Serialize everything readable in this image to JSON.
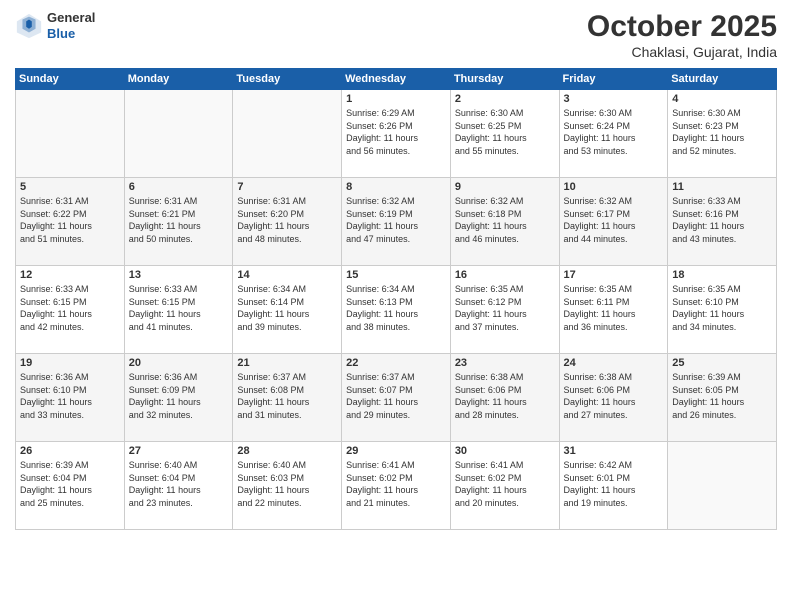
{
  "logo": {
    "general": "General",
    "blue": "Blue"
  },
  "title": "October 2025",
  "subtitle": "Chaklasi, Gujarat, India",
  "days_header": [
    "Sunday",
    "Monday",
    "Tuesday",
    "Wednesday",
    "Thursday",
    "Friday",
    "Saturday"
  ],
  "weeks": [
    [
      {
        "day": "",
        "info": ""
      },
      {
        "day": "",
        "info": ""
      },
      {
        "day": "",
        "info": ""
      },
      {
        "day": "1",
        "info": "Sunrise: 6:29 AM\nSunset: 6:26 PM\nDaylight: 11 hours\nand 56 minutes."
      },
      {
        "day": "2",
        "info": "Sunrise: 6:30 AM\nSunset: 6:25 PM\nDaylight: 11 hours\nand 55 minutes."
      },
      {
        "day": "3",
        "info": "Sunrise: 6:30 AM\nSunset: 6:24 PM\nDaylight: 11 hours\nand 53 minutes."
      },
      {
        "day": "4",
        "info": "Sunrise: 6:30 AM\nSunset: 6:23 PM\nDaylight: 11 hours\nand 52 minutes."
      }
    ],
    [
      {
        "day": "5",
        "info": "Sunrise: 6:31 AM\nSunset: 6:22 PM\nDaylight: 11 hours\nand 51 minutes."
      },
      {
        "day": "6",
        "info": "Sunrise: 6:31 AM\nSunset: 6:21 PM\nDaylight: 11 hours\nand 50 minutes."
      },
      {
        "day": "7",
        "info": "Sunrise: 6:31 AM\nSunset: 6:20 PM\nDaylight: 11 hours\nand 48 minutes."
      },
      {
        "day": "8",
        "info": "Sunrise: 6:32 AM\nSunset: 6:19 PM\nDaylight: 11 hours\nand 47 minutes."
      },
      {
        "day": "9",
        "info": "Sunrise: 6:32 AM\nSunset: 6:18 PM\nDaylight: 11 hours\nand 46 minutes."
      },
      {
        "day": "10",
        "info": "Sunrise: 6:32 AM\nSunset: 6:17 PM\nDaylight: 11 hours\nand 44 minutes."
      },
      {
        "day": "11",
        "info": "Sunrise: 6:33 AM\nSunset: 6:16 PM\nDaylight: 11 hours\nand 43 minutes."
      }
    ],
    [
      {
        "day": "12",
        "info": "Sunrise: 6:33 AM\nSunset: 6:15 PM\nDaylight: 11 hours\nand 42 minutes."
      },
      {
        "day": "13",
        "info": "Sunrise: 6:33 AM\nSunset: 6:15 PM\nDaylight: 11 hours\nand 41 minutes."
      },
      {
        "day": "14",
        "info": "Sunrise: 6:34 AM\nSunset: 6:14 PM\nDaylight: 11 hours\nand 39 minutes."
      },
      {
        "day": "15",
        "info": "Sunrise: 6:34 AM\nSunset: 6:13 PM\nDaylight: 11 hours\nand 38 minutes."
      },
      {
        "day": "16",
        "info": "Sunrise: 6:35 AM\nSunset: 6:12 PM\nDaylight: 11 hours\nand 37 minutes."
      },
      {
        "day": "17",
        "info": "Sunrise: 6:35 AM\nSunset: 6:11 PM\nDaylight: 11 hours\nand 36 minutes."
      },
      {
        "day": "18",
        "info": "Sunrise: 6:35 AM\nSunset: 6:10 PM\nDaylight: 11 hours\nand 34 minutes."
      }
    ],
    [
      {
        "day": "19",
        "info": "Sunrise: 6:36 AM\nSunset: 6:10 PM\nDaylight: 11 hours\nand 33 minutes."
      },
      {
        "day": "20",
        "info": "Sunrise: 6:36 AM\nSunset: 6:09 PM\nDaylight: 11 hours\nand 32 minutes."
      },
      {
        "day": "21",
        "info": "Sunrise: 6:37 AM\nSunset: 6:08 PM\nDaylight: 11 hours\nand 31 minutes."
      },
      {
        "day": "22",
        "info": "Sunrise: 6:37 AM\nSunset: 6:07 PM\nDaylight: 11 hours\nand 29 minutes."
      },
      {
        "day": "23",
        "info": "Sunrise: 6:38 AM\nSunset: 6:06 PM\nDaylight: 11 hours\nand 28 minutes."
      },
      {
        "day": "24",
        "info": "Sunrise: 6:38 AM\nSunset: 6:06 PM\nDaylight: 11 hours\nand 27 minutes."
      },
      {
        "day": "25",
        "info": "Sunrise: 6:39 AM\nSunset: 6:05 PM\nDaylight: 11 hours\nand 26 minutes."
      }
    ],
    [
      {
        "day": "26",
        "info": "Sunrise: 6:39 AM\nSunset: 6:04 PM\nDaylight: 11 hours\nand 25 minutes."
      },
      {
        "day": "27",
        "info": "Sunrise: 6:40 AM\nSunset: 6:04 PM\nDaylight: 11 hours\nand 23 minutes."
      },
      {
        "day": "28",
        "info": "Sunrise: 6:40 AM\nSunset: 6:03 PM\nDaylight: 11 hours\nand 22 minutes."
      },
      {
        "day": "29",
        "info": "Sunrise: 6:41 AM\nSunset: 6:02 PM\nDaylight: 11 hours\nand 21 minutes."
      },
      {
        "day": "30",
        "info": "Sunrise: 6:41 AM\nSunset: 6:02 PM\nDaylight: 11 hours\nand 20 minutes."
      },
      {
        "day": "31",
        "info": "Sunrise: 6:42 AM\nSunset: 6:01 PM\nDaylight: 11 hours\nand 19 minutes."
      },
      {
        "day": "",
        "info": ""
      }
    ]
  ]
}
